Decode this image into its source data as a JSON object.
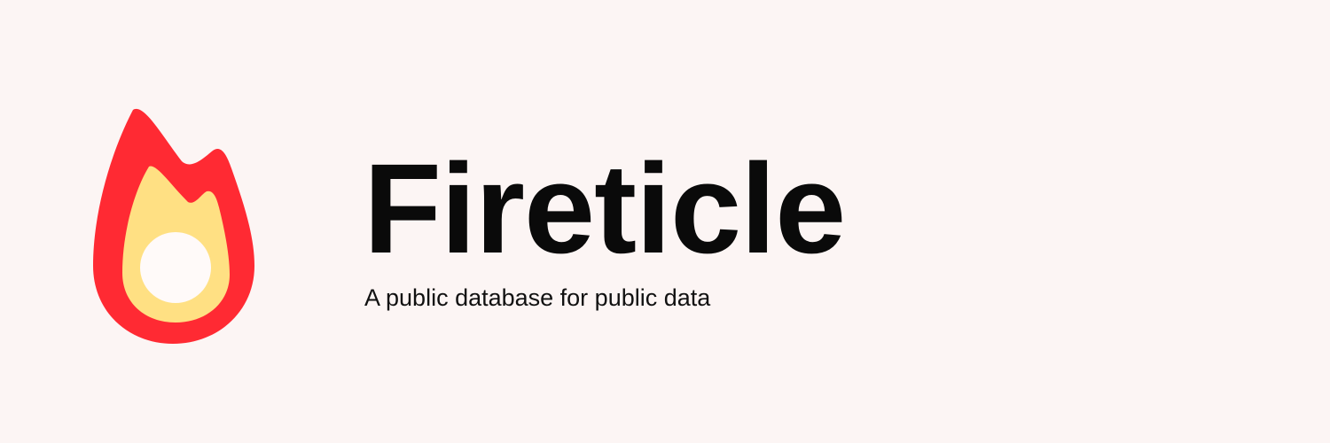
{
  "brand": {
    "name": "Fireticle",
    "tagline": "A public database for public data",
    "logo_icon": "flame-icon"
  },
  "colors": {
    "background": "#fcf5f4",
    "flame_outer": "#ff2a33",
    "flame_inner": "#ffe083",
    "flame_core": "#fffaf9",
    "text": "#0a0a0a"
  }
}
